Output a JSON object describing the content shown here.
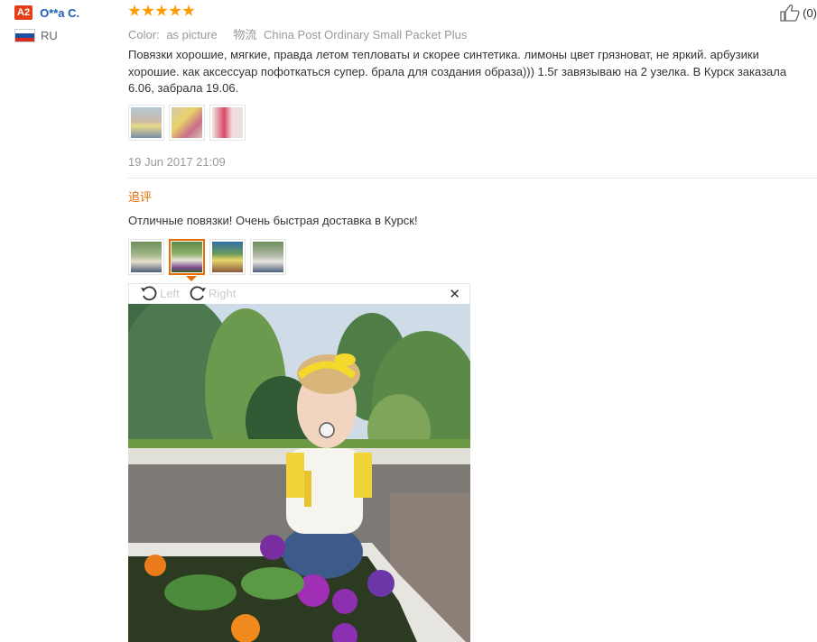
{
  "user": {
    "level": "A2",
    "name": "O**a C.",
    "country": "RU"
  },
  "review": {
    "rating": 5,
    "color_label": "Color:",
    "color_value": "as picture",
    "shipping_label": "物流",
    "shipping_value": "China Post Ordinary Small Packet Plus",
    "text_line1": "Повязки хорошие, мягкие, правда летом тепловаты и скорее синтетика. лимоны цвет грязноват, не яркий. арбузики",
    "text_line2": "хорошие. как аксессуар пофоткаться супер. брала для создания образа))) 1.5г завязываю на 2 узелка. В Курск заказала",
    "text_line3": "6.06, забрала 19.06.",
    "date": "19 Jun 2017 21:09",
    "helpful_count": "(0)",
    "accent_color": "#e66b00",
    "star_color": "#ff9a00"
  },
  "followup": {
    "label": "追评",
    "text": "Отличные повязки! Очень быстрая доставка в Курск!"
  },
  "viewer": {
    "left_label": "Left",
    "right_label": "Right",
    "close_glyph": "✕"
  },
  "icons": [
    "thumb-up-icon",
    "rotate-left-icon",
    "rotate-right-icon",
    "close-icon",
    "flag-ru-icon"
  ]
}
